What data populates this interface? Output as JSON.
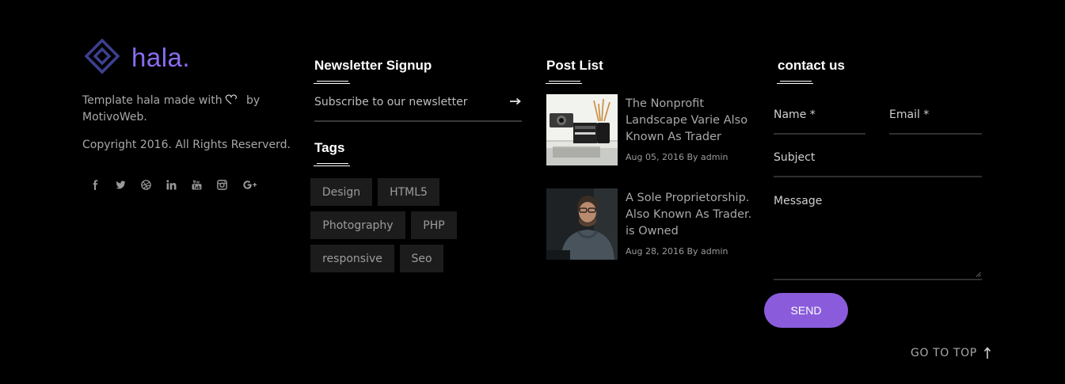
{
  "brand": {
    "name": "hala.",
    "accent": "#8a6df0",
    "logo_color": "#3d3f8f"
  },
  "about": {
    "text_before": "Template hala made with",
    "text_after": " by",
    "author": "MotivoWeb.",
    "copyright": "Copyright 2016. All Rights Reserverd."
  },
  "social": [
    {
      "icon": "facebook-icon",
      "glyph": "f"
    },
    {
      "icon": "twitter-icon",
      "glyph": "t"
    },
    {
      "icon": "dribbble-icon",
      "glyph": "d"
    },
    {
      "icon": "linkedin-icon",
      "glyph": "in"
    },
    {
      "icon": "youtube-icon",
      "glyph": "yt"
    },
    {
      "icon": "instagram-icon",
      "glyph": "ig"
    },
    {
      "icon": "google-plus-icon",
      "glyph": "G+"
    }
  ],
  "newsletter": {
    "heading": "Newsletter Signup",
    "placeholder": "Subscribe to our newsletter",
    "submit_icon": "arrow-right-icon"
  },
  "tags": {
    "heading": "Tags",
    "items": [
      "Design",
      "HTML5",
      "Photography",
      "PHP",
      "responsive",
      "Seo"
    ]
  },
  "posts": {
    "heading": "Post List",
    "items": [
      {
        "title": "The Nonprofit Landscape Varie Also Known As Trader",
        "meta": "Aug 05, 2016 By admin"
      },
      {
        "title": "A Sole Proprietorship. Also Known As Trader. is Owned",
        "meta": "Aug 28, 2016 By admin"
      }
    ]
  },
  "contact": {
    "heading": "contact us",
    "name_placeholder": "Name *",
    "email_placeholder": "Email *",
    "subject_placeholder": "Subject",
    "message_placeholder": "Message",
    "send_label": "SEND",
    "button_color": "#8a5cdb"
  },
  "footer": {
    "go_to_top": "GO TO TOP"
  }
}
